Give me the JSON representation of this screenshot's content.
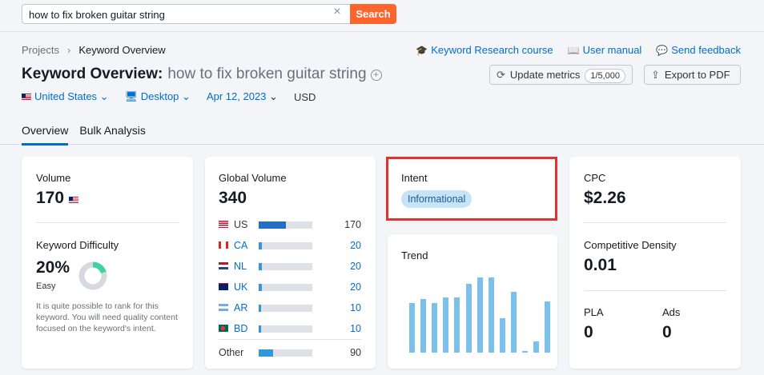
{
  "search": {
    "value": "how to fix broken guitar string",
    "button": "Search"
  },
  "breadcrumb": {
    "projects": "Projects",
    "current": "Keyword Overview"
  },
  "links": {
    "course": "Keyword Research course",
    "manual": "User manual",
    "feedback": "Send feedback"
  },
  "title": {
    "label": "Keyword Overview:",
    "keyword": "how to fix broken guitar string"
  },
  "buttons": {
    "update": "Update metrics",
    "update_badge": "1/5,000",
    "export": "Export to PDF"
  },
  "filters": {
    "country": "United States",
    "device": "Desktop",
    "date": "Apr 12, 2023",
    "currency": "USD"
  },
  "tabs": [
    "Overview",
    "Bulk Analysis"
  ],
  "volume": {
    "label": "Volume",
    "value": "170"
  },
  "kd": {
    "label": "Keyword Difficulty",
    "value": "20%",
    "level": "Easy",
    "description": "It is quite possible to rank for this keyword. You will need quality content focused on the keyword's intent.",
    "percent": 20
  },
  "global_volume": {
    "label": "Global Volume",
    "value": "340",
    "rows": [
      {
        "code": "US",
        "value": "170",
        "share": 0.5
      },
      {
        "code": "CA",
        "value": "20",
        "share": 0.06
      },
      {
        "code": "NL",
        "value": "20",
        "share": 0.06
      },
      {
        "code": "UK",
        "value": "20",
        "share": 0.06
      },
      {
        "code": "AR",
        "value": "10",
        "share": 0.03
      },
      {
        "code": "BD",
        "value": "10",
        "share": 0.03
      }
    ],
    "other": {
      "label": "Other",
      "value": "90",
      "share": 0.27
    }
  },
  "intent": {
    "label": "Intent",
    "value": "Informational"
  },
  "trend": {
    "label": "Trend",
    "values": [
      0.62,
      0.67,
      0.62,
      0.69,
      0.69,
      0.86,
      0.94,
      0.94,
      0.43,
      0.76,
      0.02,
      0.14,
      0.64
    ]
  },
  "cpc": {
    "label": "CPC",
    "value": "$2.26"
  },
  "competitive_density": {
    "label": "Competitive Density",
    "value": "0.01"
  },
  "pla": {
    "label": "PLA",
    "value": "0"
  },
  "ads": {
    "label": "Ads",
    "value": "0"
  },
  "colors": {
    "accent": "#006dca",
    "search": "#ff642d",
    "bar": "#2f99e0",
    "trend": "#7cc1ec",
    "kd_ring": "#3fd2a0",
    "highlight": "#e0332b"
  }
}
